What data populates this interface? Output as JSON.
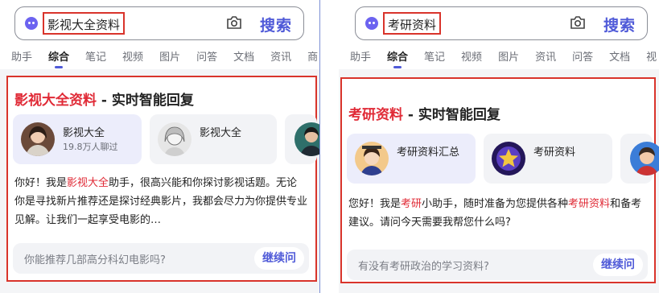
{
  "colors": {
    "accent": "#4f5ad8",
    "highlight": "#e02a36",
    "annotation": "#d9342b"
  },
  "left": {
    "query": "影视大全资料",
    "search_label": "搜索",
    "tabs": [
      "助手",
      "综合",
      "笔记",
      "视频",
      "图片",
      "问答",
      "文档",
      "资讯",
      "商"
    ],
    "active_tab": "综合",
    "title_highlight": "影视大全资料",
    "title_rest": " - 实时智能回复",
    "agents": [
      {
        "name": "影视大全",
        "meta": "19.8万人聊过",
        "icon": "woman-avatar-icon"
      },
      {
        "name": "影视大全",
        "meta": "",
        "icon": "sketch-avatar-icon"
      },
      {
        "icon": "portrait-avatar-icon"
      }
    ],
    "reply_a": "你好！我是",
    "reply_hl": "影视大全",
    "reply_b": "助手，很高兴能和你探讨影视话题。无论你是寻找新片推荐还是探讨经典影片，我都会尽力为你提供专业见解。让我们一起享受电影的…",
    "followup": "你能推荐几部高分科幻电影吗?",
    "continue_label": "继续问"
  },
  "right": {
    "query": "考研资料",
    "search_label": "搜索",
    "tabs": [
      "助手",
      "综合",
      "笔记",
      "视频",
      "图片",
      "资讯",
      "问答",
      "文档",
      "视"
    ],
    "active_tab": "综合",
    "title_highlight": "考研资料",
    "title_rest": " - 实时智能回复",
    "agents": [
      {
        "name": "考研资料汇总",
        "meta": "",
        "icon": "student-avatar-icon"
      },
      {
        "name": "考研资料",
        "meta": "",
        "icon": "star-avatar-icon"
      },
      {
        "icon": "cartoon-avatar-icon"
      }
    ],
    "reply_a": "您好！我是",
    "reply_hl": "考研",
    "reply_b": "小助手，随时准备为您提供各种",
    "reply_hl2": "考研资料",
    "reply_c": "和备考建议。请问今天需要我帮您什么吗?",
    "followup": "有没有考研政治的学习资料?",
    "continue_label": "继续问"
  }
}
